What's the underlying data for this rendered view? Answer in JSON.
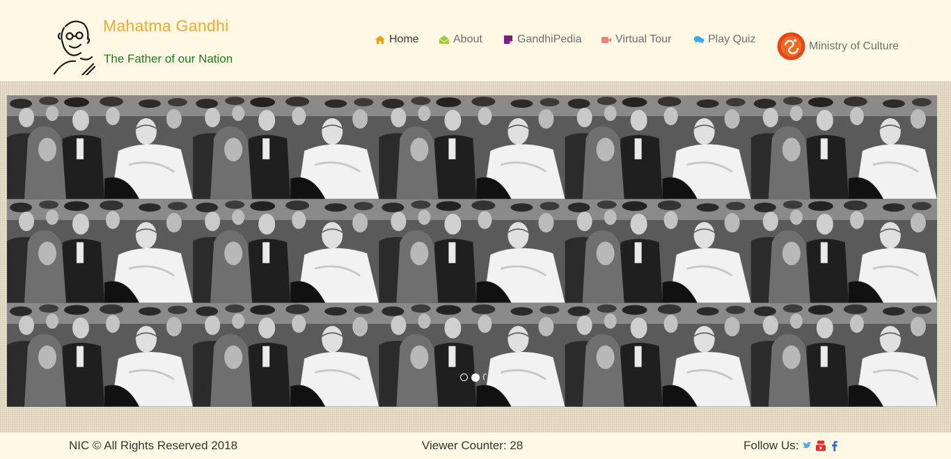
{
  "brand": {
    "title": "Mahatma Gandhi",
    "subtitle": "The Father of our Nation"
  },
  "nav": {
    "items": [
      {
        "label": "Home",
        "icon": "home-icon",
        "color": "#f39c12"
      },
      {
        "label": "About",
        "icon": "envelope-open-icon",
        "color": "#9acd32"
      },
      {
        "label": "GandhiPedia",
        "icon": "sticky-note-icon",
        "color": "#7b1f7e"
      },
      {
        "label": "Virtual Tour",
        "icon": "video-camera-icon",
        "color": "#f08080"
      },
      {
        "label": "Play Quiz",
        "icon": "comments-icon",
        "color": "#3ea8e8"
      }
    ],
    "ministry": {
      "label": "Ministry of Culture",
      "icon": "ministry-emblem-icon",
      "color": "#e8431a"
    }
  },
  "slider": {
    "image": "photo of Gandhi with crowd (tiled)",
    "dots_count": 3,
    "active_dot": 2
  },
  "footer": {
    "copyright": "NIC © All Rights Reserved 2018",
    "viewer_counter": "Viewer Counter: 28",
    "follow_label": "Follow Us:",
    "social": [
      {
        "icon": "twitter-icon",
        "color": "#55acee"
      },
      {
        "icon": "youtube-icon",
        "color": "#e52d27"
      },
      {
        "icon": "facebook-icon",
        "color": "#2d6bd8"
      }
    ]
  }
}
